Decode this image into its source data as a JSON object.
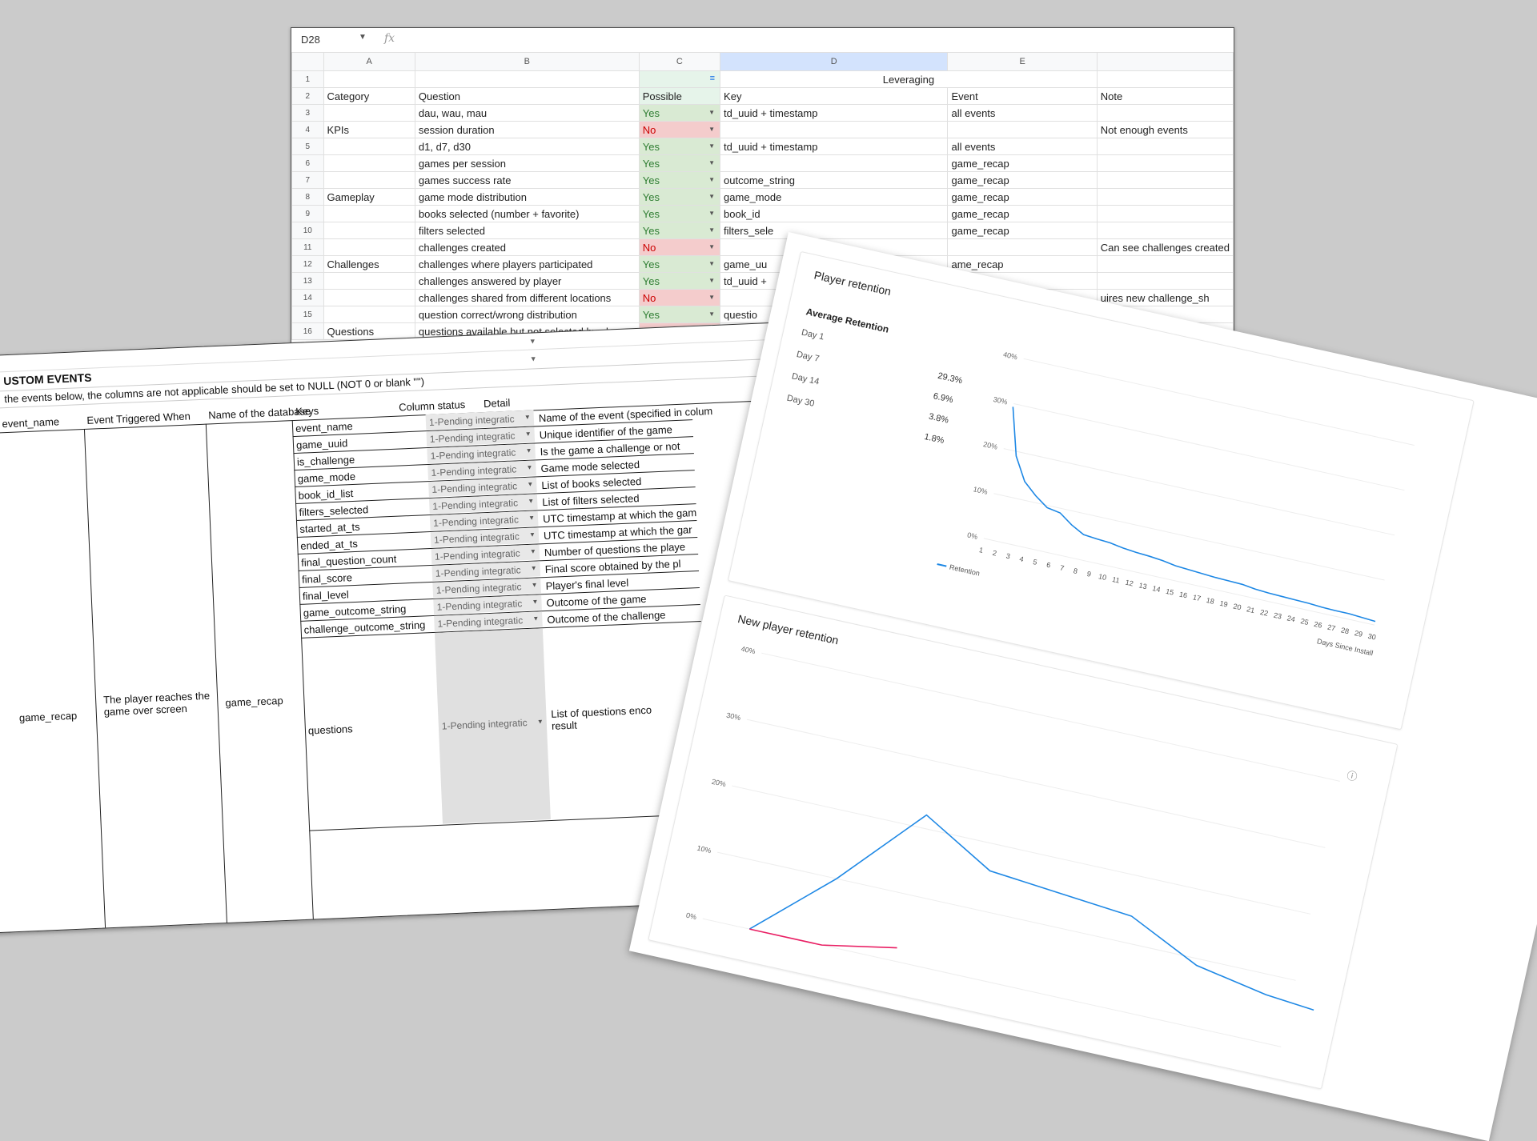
{
  "sheet1": {
    "name_box": "D28",
    "fx_label": "fx",
    "columns": [
      "A",
      "B",
      "C",
      "D",
      "E",
      ""
    ],
    "header_row1": {
      "leveraging": "Leveraging"
    },
    "header_row2": [
      "Category",
      "Question",
      "Possible",
      "Key",
      "Event",
      "Note"
    ],
    "rows": [
      {
        "num": "3",
        "cat": "",
        "q": "dau, wau, mau",
        "p": "Yes",
        "key": "td_uuid + timestamp",
        "ev": "all events",
        "note": ""
      },
      {
        "num": "4",
        "cat": "KPIs",
        "q": "session duration",
        "p": "No",
        "key": "",
        "ev": "",
        "note": "Not enough events"
      },
      {
        "num": "5",
        "cat": "",
        "q": "d1, d7, d30",
        "p": "Yes",
        "key": "td_uuid + timestamp",
        "ev": "all events",
        "note": ""
      },
      {
        "num": "6",
        "cat": "",
        "q": "games per session",
        "p": "Yes",
        "key": "",
        "ev": "game_recap",
        "note": ""
      },
      {
        "num": "7",
        "cat": "",
        "q": "games success rate",
        "p": "Yes",
        "key": "outcome_string",
        "ev": "game_recap",
        "note": ""
      },
      {
        "num": "8",
        "cat": "Gameplay",
        "q": "game mode distribution",
        "p": "Yes",
        "key": "game_mode",
        "ev": "game_recap",
        "note": ""
      },
      {
        "num": "9",
        "cat": "",
        "q": "books selected (number + favorite)",
        "p": "Yes",
        "key": "book_id",
        "ev": "game_recap",
        "note": ""
      },
      {
        "num": "10",
        "cat": "",
        "q": "filters selected",
        "p": "Yes",
        "key": "filters_sele",
        "ev": "game_recap",
        "note": ""
      },
      {
        "num": "11",
        "cat": "",
        "q": "challenges created",
        "p": "No",
        "key": "",
        "ev": "",
        "note": "Can see challenges created"
      },
      {
        "num": "12",
        "cat": "Challenges",
        "q": "challenges where players participated",
        "p": "Yes",
        "key": "game_uu",
        "ev": "ame_recap",
        "note": ""
      },
      {
        "num": "13",
        "cat": "",
        "q": "challenges answered by player",
        "p": "Yes",
        "key": "td_uuid +",
        "ev": "",
        "note": ""
      },
      {
        "num": "14",
        "cat": "",
        "q": "challenges shared from different locations",
        "p": "No",
        "key": "",
        "ev": "",
        "note": "uires new challenge_sh"
      },
      {
        "num": "15",
        "cat": "",
        "q": "question correct/wrong distribution",
        "p": "Yes",
        "key": "questio",
        "ev": "",
        "note": ""
      },
      {
        "num": "16",
        "cat": "Questions",
        "q": "questions available but not selected by player",
        "p": "No",
        "key": "",
        "ev": "",
        "note": ""
      }
    ]
  },
  "sheet2": {
    "title": "USTOM EVENTS",
    "note": "the events below, the columns are not applicable should be set to NULL (NOT 0 or blank \"\")",
    "headers": [
      "event_name",
      "Event Triggered When",
      "Name of the database",
      "Keys",
      "Column status",
      "Detail"
    ],
    "event_name": "game_recap",
    "triggered_when": "The player reaches the game over screen",
    "database": "game_recap",
    "status_label": "1-Pending integratic",
    "keys": [
      {
        "key": "event_name",
        "detail": "Name of the event (specified in colum"
      },
      {
        "key": "game_uuid",
        "detail": "Unique identifier of the game"
      },
      {
        "key": "is_challenge",
        "detail": "Is the game a challenge or not"
      },
      {
        "key": "game_mode",
        "detail": "Game mode selected"
      },
      {
        "key": "book_id_list",
        "detail": "List of books selected"
      },
      {
        "key": "filters_selected",
        "detail": "List of filters selected"
      },
      {
        "key": "started_at_ts",
        "detail": "UTC timestamp at which the gam"
      },
      {
        "key": "ended_at_ts",
        "detail": "UTC timestamp at which the gar"
      },
      {
        "key": "final_question_count",
        "detail": "Number of questions the playe"
      },
      {
        "key": "final_score",
        "detail": "Final score obtained by the pl"
      },
      {
        "key": "final_level",
        "detail": "Player's final level"
      },
      {
        "key": "game_outcome_string",
        "detail": "Outcome of the game"
      },
      {
        "key": "challenge_outcome_string",
        "detail": "Outcome of the challenge"
      }
    ],
    "questions_key": "questions",
    "questions_detail": "List of questions enco result"
  },
  "dashboard": {
    "card1_title": "Player retention",
    "avg_title": "Average Retention",
    "avg_rows": [
      {
        "label": "Day 1",
        "value": ""
      },
      {
        "label": "Day 7",
        "value": "29.3%"
      },
      {
        "label": "Day 14",
        "value": "6.9%"
      },
      {
        "label": "Day 30",
        "value": "3.8%"
      },
      {
        "label": "",
        "value": "1.8%"
      }
    ],
    "card2_title": "New player retention",
    "info_icon": "ⓘ",
    "colors": {
      "line": "#1e88e5",
      "pink": "#e91e63"
    }
  },
  "chart_data": [
    {
      "type": "line",
      "xlabel": "Days Since Install",
      "ylabel": "",
      "yticks": [
        "0%",
        "10%",
        "20%",
        "30%",
        "40%"
      ],
      "ylim": [
        0,
        40
      ],
      "x": [
        1,
        2,
        3,
        4,
        5,
        6,
        7,
        8,
        9,
        10,
        11,
        12,
        13,
        14,
        15,
        16,
        17,
        18,
        19,
        20,
        21,
        22,
        23,
        24,
        25,
        26,
        27,
        28,
        29,
        30
      ],
      "series": [
        {
          "name": "Retention",
          "values": [
            29.3,
            19,
            14,
            11.5,
            9.5,
            9,
            7,
            5.5,
            5.2,
            5,
            4.5,
            4.2,
            4,
            3.7,
            3.2,
            3,
            2.8,
            2.6,
            2.5,
            2.4,
            2,
            1.8,
            1.7,
            1.6,
            1.5,
            1.3,
            1.2,
            1.2,
            1.0,
            0.8
          ]
        }
      ],
      "legend": "bottom-left"
    },
    {
      "type": "line",
      "yticks": [
        "0%",
        "10%",
        "20%",
        "30%",
        "40%"
      ],
      "ylim": [
        0,
        40
      ],
      "series": [
        {
          "values": [
            0,
            10,
            22,
            16,
            15,
            14,
            9,
            7,
            6
          ]
        },
        {
          "values": [
            0,
            0,
            2
          ]
        }
      ]
    }
  ]
}
